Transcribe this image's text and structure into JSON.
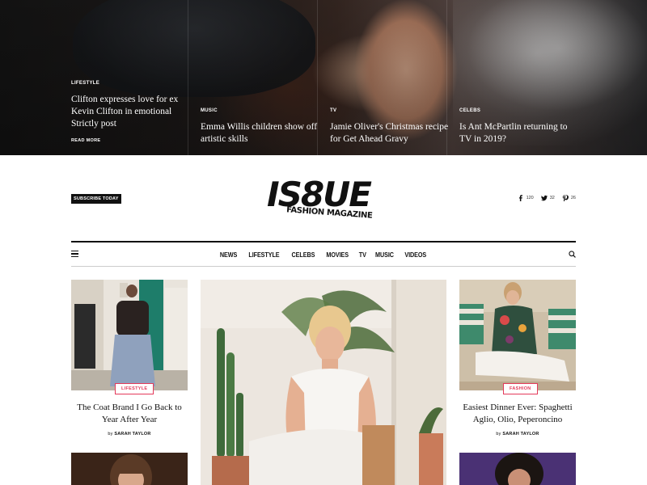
{
  "hero": {
    "stories": [
      {
        "category": "Lifestyle",
        "title": "Clifton expresses love for ex Kevin Clifton in emotional Strictly post",
        "read_more": "Read more"
      },
      {
        "category": "Music",
        "title": "Emma Willis children show off artistic skills"
      },
      {
        "category": "TV",
        "title": "Jamie Oliver's Christmas recipe for Get Ahead Gravy"
      },
      {
        "category": "Celebs",
        "title": "Is Ant McPartlin returning to TV in 2019?"
      }
    ]
  },
  "masthead": {
    "subscribe_label": "Subscribe today",
    "logo_text": "IS8UE",
    "logo_subtitle": "FASHION MAGAZINE",
    "social": [
      {
        "icon": "facebook-icon",
        "count": "120"
      },
      {
        "icon": "twitter-icon",
        "count": "32"
      },
      {
        "icon": "pinterest-icon",
        "count": "26"
      }
    ]
  },
  "nav": {
    "items": [
      "News",
      "Lifestyle",
      "Celebs",
      "Movies",
      "TV",
      "Music",
      "Videos"
    ]
  },
  "articles": [
    {
      "tag": "Lifestyle",
      "title": "The Coat Brand I Go Back to Year After Year",
      "by": "by",
      "author": "Sarah Taylor"
    },
    {
      "tag": "Fashion",
      "title": "Easiest Dinner Ever: Spaghetti Aglio, Olio, Peperoncino",
      "by": "by",
      "author": "Sarah Taylor"
    }
  ],
  "colors": {
    "accent": "#e43a5a",
    "text": "#111111",
    "background": "#ffffff"
  }
}
